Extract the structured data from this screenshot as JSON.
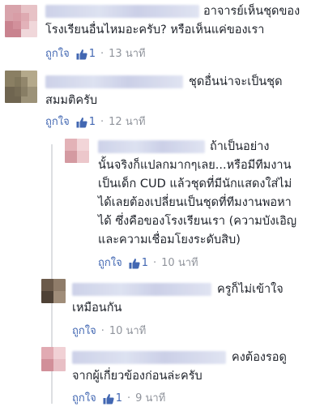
{
  "comments": [
    {
      "text": "อาจารย์เห็นชุดของ\nโรงเรียนอื่นไหมอะครับ? หรือเห็นแค่ของเรา",
      "like_label": "ถูกใจ",
      "likes": "1",
      "time": "13 นาที",
      "avatar_colors": [
        "#d8a3ab",
        "#e7c2c6",
        "#c9838f",
        "#f0d7da"
      ]
    },
    {
      "text": "ชุดอื่นน่าจะเป็นชุด\nสมมติครับ",
      "like_label": "ถูกใจ",
      "likes": "1",
      "time": "12 นาที",
      "avatar_colors": [
        "#8a7f63",
        "#b4a98b",
        "#6f6550",
        "#9c9278"
      ]
    }
  ],
  "replies": [
    {
      "text": "ถ้าเป็นอย่าง\nนั้นจริงก็แปลกมากๆเลย...หรือมีทีมงาน\nเป็นเด็ก CUD แล้วชุดที่มีนักแสดงใส่ไม่\nได้เลยต้องเปลี่ยนเป็นชุดที่ทีมงานพอหา\nได้ ซึ่งคือของโรงเรียนเรา (ความบังเอิญ\nและความเชื่อมโยงระดับสิบ)",
      "like_label": "ถูกใจ",
      "likes": "1",
      "time": "10 นาที",
      "avatar_colors": [
        "#e3b2b7",
        "#f2d5d8",
        "#d49aa1",
        "#ecc7cb"
      ]
    },
    {
      "text": "ครูก็ไม่เข้าใจ\nเหมือนกัน",
      "like_label": "ถูกใจ",
      "likes": "",
      "time": "10 นาที",
      "avatar_colors": [
        "#6b5a4a",
        "#8f7c69",
        "#4f4236",
        "#a08d79"
      ]
    },
    {
      "text": "คงต้องรอดู\nจากผู้เกี่ยวข้องก่อนล่ะครับ",
      "like_label": "ถูกใจ",
      "likes": "1",
      "time": "9 นาที",
      "avatar_colors": [
        "#e1aab2",
        "#f1d1d5",
        "#d18f99",
        "#e8bfc5"
      ]
    }
  ],
  "colors": {
    "link": "#4267b2",
    "meta": "#90949c",
    "text": "#1d2129"
  },
  "icons": {
    "like": "thumbs-up-icon"
  }
}
